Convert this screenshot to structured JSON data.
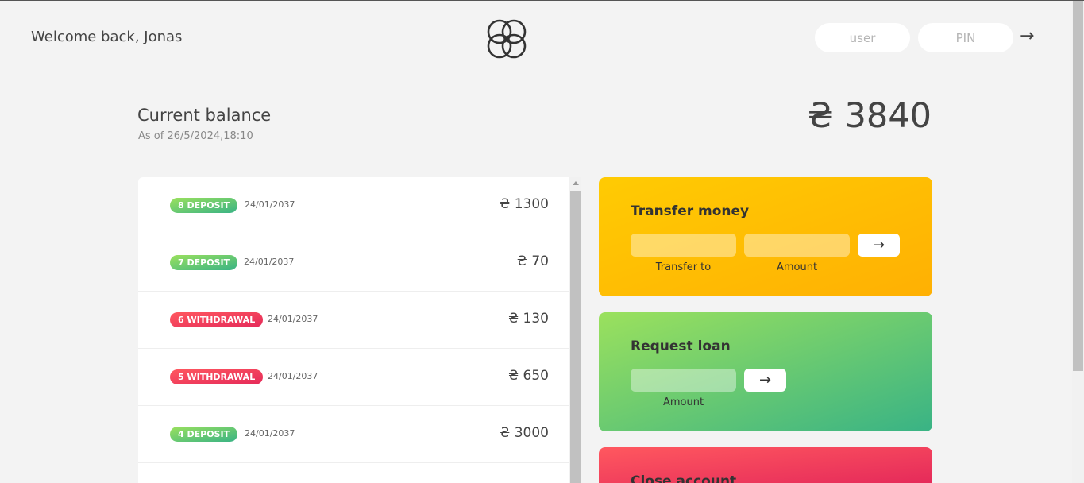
{
  "nav": {
    "welcome": "Welcome back, Jonas",
    "user_placeholder": "user",
    "pin_placeholder": "PIN",
    "login_arrow": "→"
  },
  "balance": {
    "label": "Current balance",
    "date": "As of 26/5/2024,18:10",
    "value": "₴ 3840"
  },
  "movements": [
    {
      "type": "8 DEPOSIT",
      "kind": "deposit",
      "date": "24/01/2037",
      "value": "₴ 1300"
    },
    {
      "type": "7 DEPOSIT",
      "kind": "deposit",
      "date": "24/01/2037",
      "value": "₴ 70"
    },
    {
      "type": "6 WITHDRAWAL",
      "kind": "withdrawal",
      "date": "24/01/2037",
      "value": "₴ 130"
    },
    {
      "type": "5 WITHDRAWAL",
      "kind": "withdrawal",
      "date": "24/01/2037",
      "value": "₴ 650"
    },
    {
      "type": "4 DEPOSIT",
      "kind": "deposit",
      "date": "24/01/2037",
      "value": "₴ 3000"
    }
  ],
  "operations": {
    "transfer": {
      "title": "Transfer money",
      "to_label": "Transfer to",
      "amount_label": "Amount",
      "button": "→"
    },
    "loan": {
      "title": "Request loan",
      "amount_label": "Amount",
      "button": "→"
    },
    "close": {
      "title": "Close account"
    }
  },
  "colors": {
    "deposit": "#39b385",
    "withdrawal": "#e52a5a",
    "transfer": "#ffb003",
    "background": "#f3f3f3"
  }
}
